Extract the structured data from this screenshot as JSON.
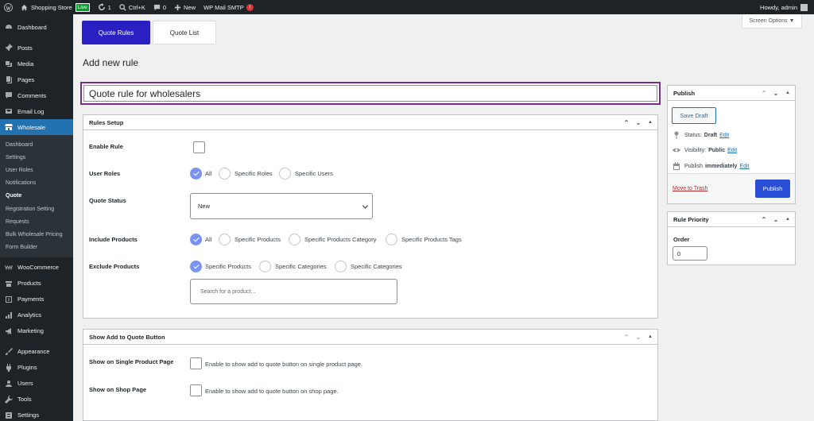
{
  "adminbar": {
    "site_name": "Shopping Store",
    "live_badge": "Live",
    "updates_count": "1",
    "search_shortcut": "Ctrl+K",
    "comments_count": "0",
    "new_label": "New",
    "smtp_label": "WP Mail SMTP",
    "smtp_alert": "!",
    "howdy": "Howdy, admin"
  },
  "sidebar": {
    "top_items": [
      {
        "label": "Dashboard",
        "icon": "dashboard-icon"
      },
      {
        "label": "Posts",
        "icon": "pin-icon"
      },
      {
        "label": "Media",
        "icon": "media-icon"
      },
      {
        "label": "Pages",
        "icon": "pages-icon"
      },
      {
        "label": "Comments",
        "icon": "comment-icon"
      },
      {
        "label": "Email Log",
        "icon": "email-icon"
      },
      {
        "label": "Wholesale",
        "icon": "store-icon"
      }
    ],
    "submenu": [
      "Dashboard",
      "Settings",
      "User Roles",
      "Notifications",
      "Quote",
      "Registration Setting",
      "Requests",
      "Bulk Wholesale Pricing",
      "Form Builder"
    ],
    "bottom_items": [
      {
        "label": "WooCommerce",
        "icon": "woo-icon"
      },
      {
        "label": "Products",
        "icon": "archive-icon"
      },
      {
        "label": "Payments",
        "icon": "dollar-icon"
      },
      {
        "label": "Analytics",
        "icon": "chart-icon"
      },
      {
        "label": "Marketing",
        "icon": "megaphone-icon"
      },
      {
        "label": "Appearance",
        "icon": "brush-icon"
      },
      {
        "label": "Plugins",
        "icon": "plug-icon"
      },
      {
        "label": "Users",
        "icon": "user-icon"
      },
      {
        "label": "Tools",
        "icon": "wrench-icon"
      },
      {
        "label": "Settings",
        "icon": "settings-icon"
      }
    ]
  },
  "tabs": {
    "quote_rules": "Quote Rules",
    "quote_list": "Quote List"
  },
  "screen_options": "Screen Options ▼",
  "page_title": "Add new rule",
  "rule_title": "Quote rule for wholesalers",
  "rules_setup": {
    "header": "Rules Setup",
    "enable_rule": "Enable Rule",
    "user_roles": {
      "label": "User Roles",
      "options": [
        "All",
        "Specific Roles",
        "Specific Users"
      ]
    },
    "quote_status": {
      "label": "Quote Status",
      "value": "New"
    },
    "include_products": {
      "label": "Include Products",
      "options": [
        "All",
        "Specific Products",
        "Specific Products Category",
        "Specific Products Tags"
      ]
    },
    "exclude_products": {
      "label": "Exclude Products",
      "options": [
        "Specific Products",
        "Specific Categories",
        "Specific Categories"
      ],
      "search_placeholder": "Search for a product..."
    }
  },
  "show_add": {
    "header": "Show Add to Quote Button",
    "single_label": "Show on Single Product Page",
    "single_help": "Enable to show add to quote button on single product page.",
    "shop_label": "Show on Shop Page",
    "shop_help": "Enable to show add to quote button on shop page."
  },
  "publish": {
    "header": "Publish",
    "save_draft": "Save Draft",
    "status_label": "Status:",
    "status_value": "Draft",
    "visibility_label": "Visibility:",
    "visibility_value": "Public",
    "publish_label": "Publish",
    "publish_value": "immediately",
    "edit": "Edit",
    "trash": "Move to Trash",
    "publish_button": "Publish"
  },
  "priority": {
    "header": "Rule Priority",
    "order_label": "Order",
    "order_value": "0"
  }
}
